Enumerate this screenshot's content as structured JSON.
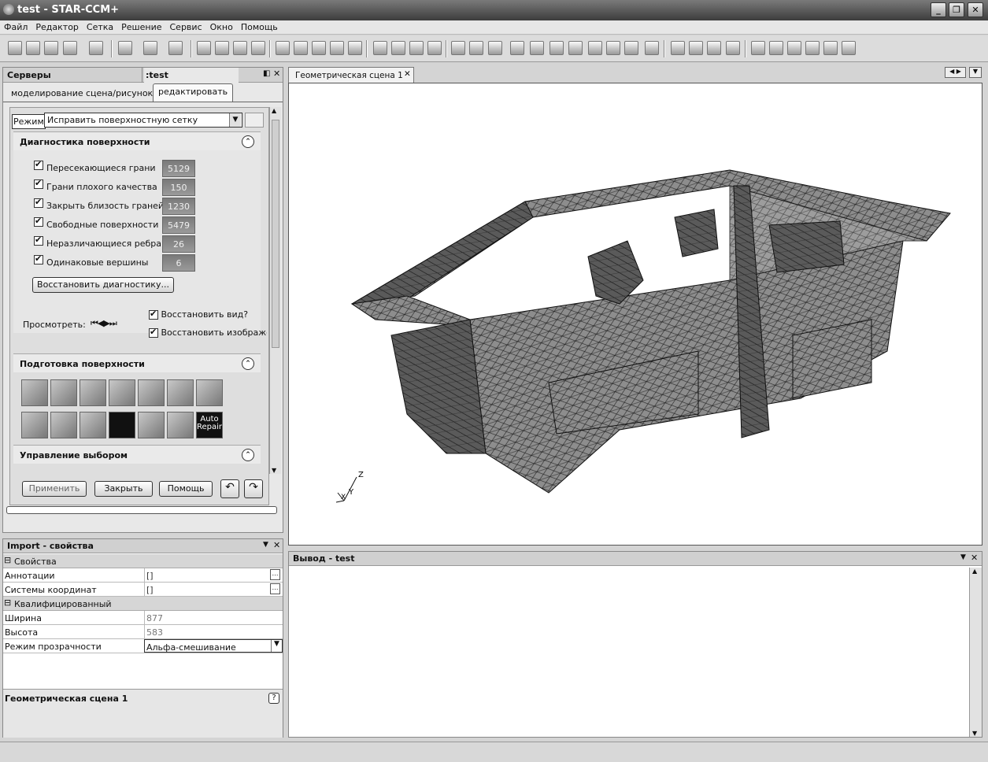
{
  "window": {
    "title": "test - STAR-CCM+"
  },
  "menu": [
    "Файл",
    "Редактор",
    "Сетка",
    "Решение",
    "Сервис",
    "Окно",
    "Помощь"
  ],
  "left_panel": {
    "tab_servers": "Серверы",
    "tab_test": ":test",
    "subtabs": [
      "моделирование",
      "сцена/рисунок",
      "редактировать"
    ],
    "mode_label": "Режим",
    "mode_value": "Исправить поверхностную сетку",
    "diag_title": "Диагностика поверхности",
    "diagnostics": [
      {
        "label": "Пересекающиеся грани",
        "value": "5129"
      },
      {
        "label": "Грани плохого качества",
        "value": "150"
      },
      {
        "label": "Закрыть близость граней",
        "value": "1230"
      },
      {
        "label": "Свободные поверхности",
        "value": "5479"
      },
      {
        "label": "Неразличающиеся ребра",
        "value": "26"
      },
      {
        "label": "Одинаковые вершины",
        "value": "6"
      }
    ],
    "restore_btn": "Восстановить диагностику...",
    "view_label": "Просмотреть:",
    "restore_view": "Восстановить вид?",
    "restore_image": "Восстановить изображе",
    "prep_title": "Подготовка поверхности",
    "auto_repair": "Auto Repair",
    "select_title": "Управление выбором",
    "apply_btn": "Применить",
    "close_btn": "Закрыть",
    "help_btn": "Помощь"
  },
  "properties": {
    "title": "Import - свойства",
    "group1": "Свойства",
    "annotations_k": "Аннотации",
    "annotations_v": "[]",
    "coords_k": "Системы координат",
    "coords_v": "[]",
    "group2": "Квалифицированный",
    "width_k": "Ширина",
    "width_v": "877",
    "height_k": "Высота",
    "height_v": "583",
    "transp_k": "Режим прозрачности",
    "transp_v": "Альфа-смешивание",
    "footer": "Геометрическая сцена 1"
  },
  "scene": {
    "tab": "Геометрическая сцена 1",
    "axis_z": "Z",
    "axis_y": "Y",
    "axis_x": "X"
  },
  "output": {
    "title": "Вывод - test"
  }
}
